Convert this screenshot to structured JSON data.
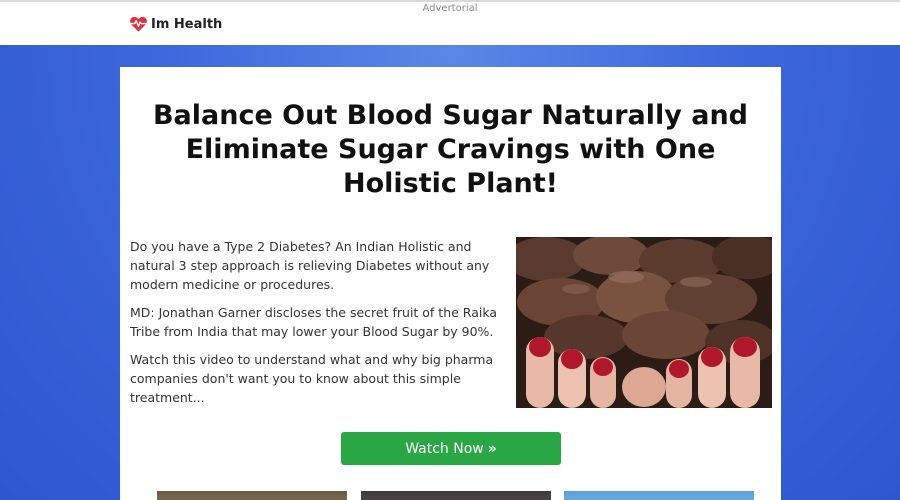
{
  "header": {
    "advertorial_label": "Advertorial",
    "logo_text": "Im Health",
    "logo_icon": "heart-pulse-icon",
    "accent_color": "#e0303a"
  },
  "article": {
    "headline": "Balance Out Blood Sugar Naturally and Eliminate Sugar Cravings with One Holistic Plant!",
    "paragraphs": [
      "Do you have a Type 2 Diabetes? An Indian Holistic and natural 3 step approach is relieving Diabetes without any modern medicine or procedures.",
      "MD: Jonathan Garner discloses the secret fruit of the Raika Tribe from India that may lower your Blood Sugar by 90%.",
      "Watch this video to understand what and why big pharma companies don't want you to know about this simple treatment..."
    ],
    "cta_label": "Watch Now",
    "cta_icon": "double-chevron-right-icon",
    "cta_color": "#2aa745"
  },
  "theme": {
    "background": "#3d67dc"
  }
}
